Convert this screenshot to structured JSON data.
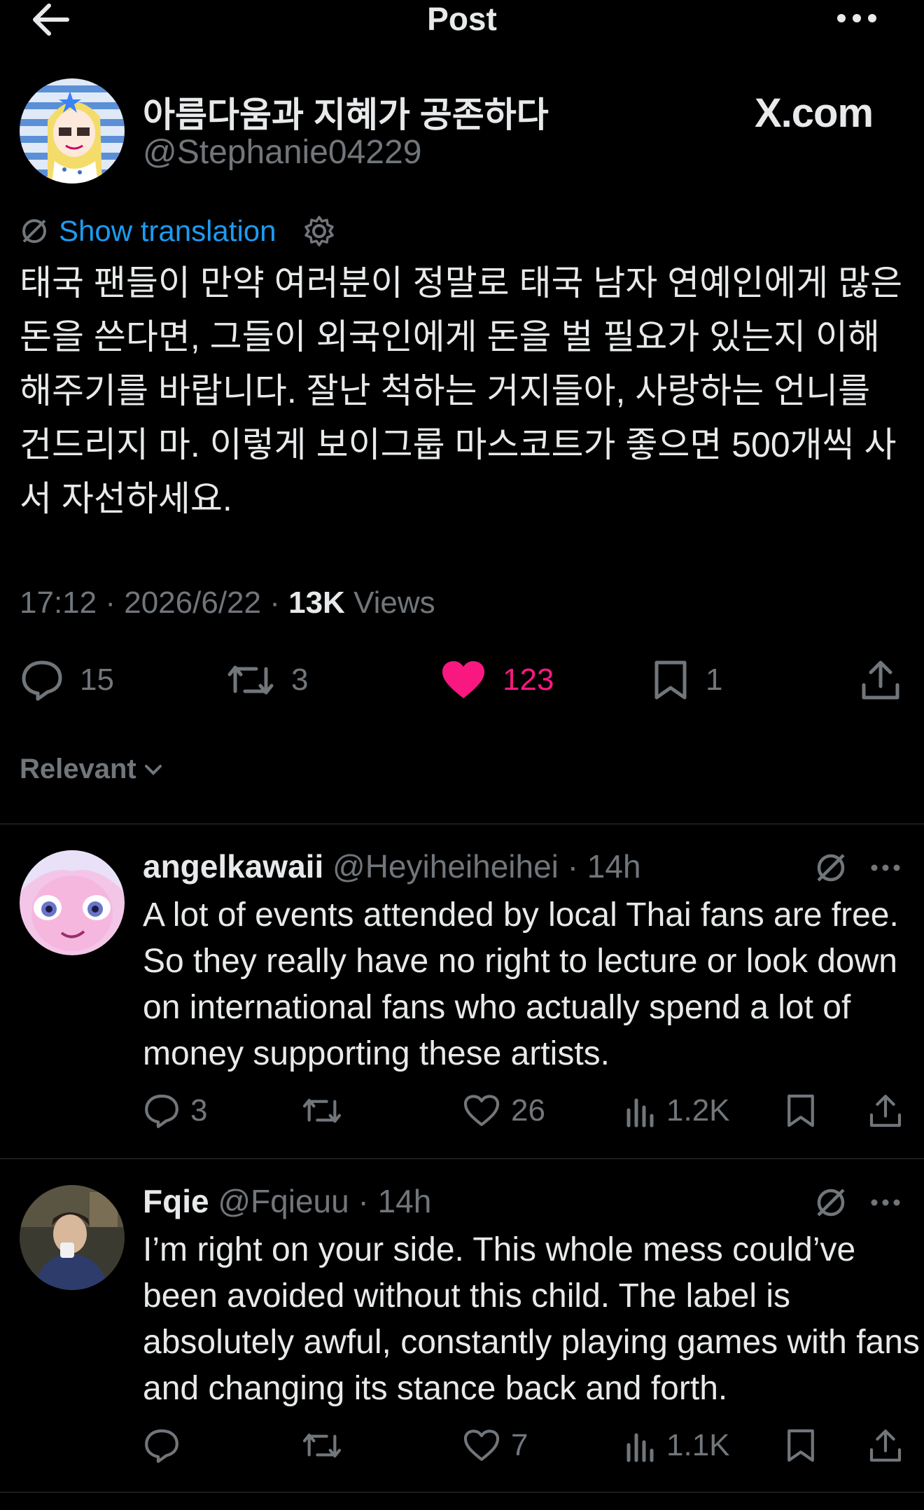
{
  "header": {
    "title": "Post"
  },
  "post": {
    "author_name": "아름다움과 지혜가 공존하다",
    "author_handle": "@Stephanie04229",
    "watermark": "X.com",
    "translate_label": "Show translation",
    "text": "태국 팬들이 만약 여러분이 정말로 태국 남자 연예인에게 많은 돈을 쓴다면, 그들이 외국인에게 돈을 벌 필요가 있는지 이해해주기를 바랍니다. 잘난 척하는 거지들아, 사랑하는 언니를 건드리지 마. 이렇게 보이그룹 마스코트가 좋으면 500개씩 사서 자선하세요.",
    "time": "17:12",
    "date": "2026/6/22",
    "views_count": "13K",
    "views_label": "Views",
    "stats": {
      "replies": "15",
      "reposts": "3",
      "likes": "123",
      "bookmarks": "1"
    }
  },
  "sort": {
    "label": "Relevant"
  },
  "replies": [
    {
      "name": "angelkawaii",
      "handle": "@Heyiheiheihei",
      "time": "14h",
      "text": "A lot of events attended by local Thai fans are free. So they really have no right to lecture or look down on international fans who actually spend a lot of money supporting these artists.",
      "stats": {
        "replies": "3",
        "reposts": "",
        "likes": "26",
        "views": "1.2K"
      }
    },
    {
      "name": "Fqie",
      "handle": "@Fqieuu",
      "time": "14h",
      "text": "I’m right on your side. This whole mess could’ve been avoided without this child. The label is absolutely awful, constantly playing games with fans and changing its stance back and forth.",
      "stats": {
        "replies": "",
        "reposts": "",
        "likes": "7",
        "views": "1.1K"
      }
    }
  ],
  "colors": {
    "background": "#000000",
    "text": "#e7e9ea",
    "muted": "#71767b",
    "link": "#1d9bf0",
    "like": "#f91880",
    "divider": "#2f3336"
  }
}
